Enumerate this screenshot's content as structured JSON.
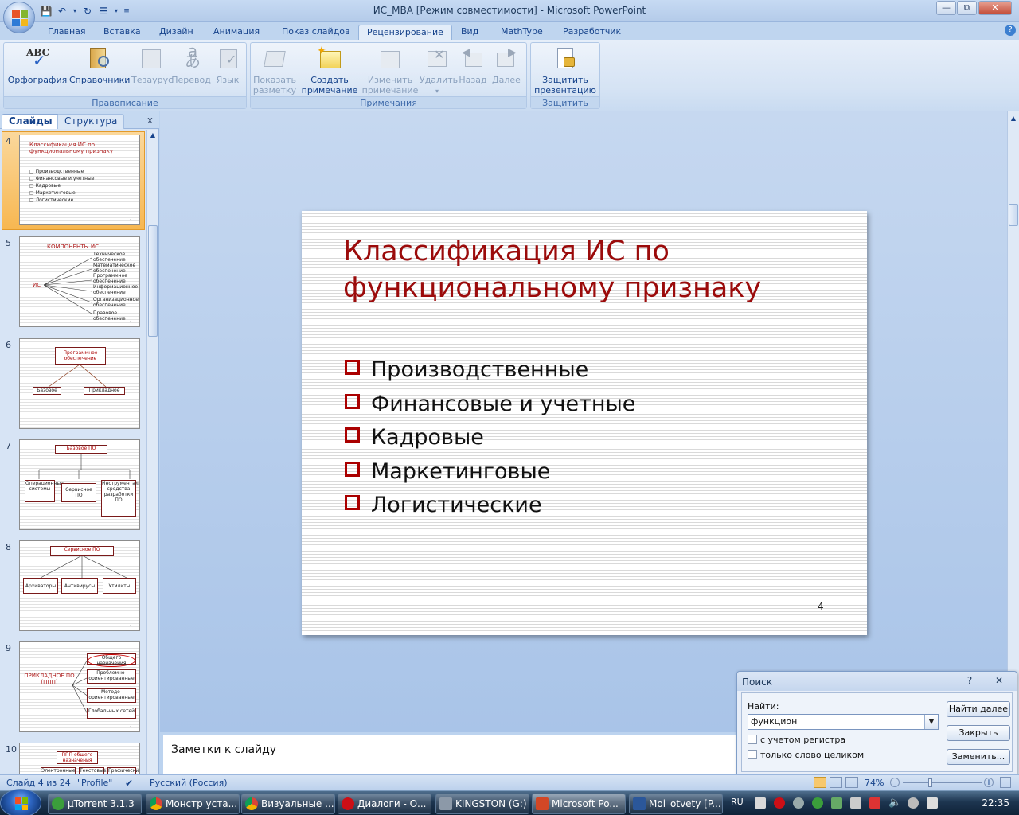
{
  "window": {
    "title": "ИС_МВА [Режим совместимости] - Microsoft PowerPoint"
  },
  "tabs": [
    "Главная",
    "Вставка",
    "Дизайн",
    "Анимация",
    "Показ слайдов",
    "Рецензирование",
    "Вид",
    "MathType",
    "Разработчик"
  ],
  "active_tab": "Рецензирование",
  "ribbon": {
    "groups": [
      {
        "label": "Правописание",
        "buttons": [
          "Орфография",
          "Справочники",
          "Тезаурус",
          "Перевод",
          "Язык"
        ]
      },
      {
        "label": "Примечания",
        "buttons": [
          "Показать разметку",
          "Создать примечание",
          "Изменить примечание",
          "Удалить",
          "Назад",
          "Далее"
        ]
      },
      {
        "label": "Защитить",
        "buttons": [
          "Защитить презентацию"
        ]
      }
    ],
    "b": {
      "spell": "Орфография",
      "research": "Справочники",
      "thesaurus": "Тезаурус",
      "translate": "Перевод",
      "language": "Язык",
      "show1": "Показать",
      "show2": "разметку",
      "new1": "Создать",
      "new2": "примечание",
      "edit1": "Изменить",
      "edit2": "примечание",
      "delete": "Удалить",
      "prev": "Назад",
      "next": "Далее",
      "protect1": "Защитить",
      "protect2": "презентацию"
    },
    "g": {
      "proofing": "Правописание",
      "comments": "Примечания",
      "protect": "Защитить"
    }
  },
  "left_pane": {
    "tab_slides": "Слайды",
    "tab_outline": "Структура",
    "close": "x",
    "slides": [
      {
        "num": "4",
        "title": "Классификация ИС по функциональному признаку",
        "items": [
          "Производственные",
          "Финансовые и учетные",
          "Кадровые",
          "Маркетинговые",
          "Логистические"
        ]
      },
      {
        "num": "5",
        "title": "КОМПОНЕНТЫ ИС",
        "root": "ИС",
        "items": [
          "Техническое обеспечение",
          "Математическое обеспечение",
          "Программное обеспечение",
          "Информационное обеспечение",
          "Организационное обеспечение",
          "Правовое обеспечение"
        ]
      },
      {
        "num": "6",
        "top": "Программное обеспечение",
        "items": [
          "Базовое",
          "Прикладное"
        ]
      },
      {
        "num": "7",
        "top": "Базовое ПО",
        "items": [
          "Операционные системы",
          "Сервисное ПО",
          "Инструментальные средства разработки ПО"
        ]
      },
      {
        "num": "8",
        "top": "Сервисное ПО",
        "items": [
          "Архиваторы",
          "Антивирусы",
          "Утилиты"
        ]
      },
      {
        "num": "9",
        "root": "ПРИКЛАДНОЕ ПО (ППП)",
        "items": [
          "Общего назначения",
          "Проблемно-ориентированные",
          "Методо-ориентированные",
          "Глобальных сетей"
        ]
      },
      {
        "num": "10",
        "top": "ППП общего назначения",
        "items": [
          "Электронные",
          "Текстовые",
          "Графические"
        ]
      }
    ]
  },
  "slide": {
    "title": "Классификация ИС по функциональному признаку",
    "bullets": [
      "Производственные",
      "Финансовые и учетные",
      "Кадровые",
      "Маркетинговые",
      "Логистические"
    ],
    "page_number": "4"
  },
  "notes": {
    "placeholder": "Заметки к слайду"
  },
  "find_dialog": {
    "title": "Поиск",
    "help": "?",
    "close": "✕",
    "find_label": "Найти:",
    "find_value": "функцион",
    "match_case": "с учетом регистра",
    "whole_word": "только слово целиком",
    "btn_find_next": "Найти далее",
    "btn_close": "Закрыть",
    "btn_replace": "Заменить..."
  },
  "status": {
    "slide_of": "Слайд 4 из 24",
    "theme": "\"Profile\"",
    "language": "Русский (Россия)",
    "zoom": "74%"
  },
  "taskbar": {
    "items": [
      "µTorrent 3.1.3",
      "Монстр уста...",
      "Визуальные ...",
      "Диалоги - О...",
      "KINGSTON (G:)",
      "Microsoft Po...",
      "Moi_otvety [P..."
    ],
    "lang": "RU",
    "clock": "22:35"
  },
  "colors": {
    "title_red": "#9b0b0b",
    "accent_blue": "#15428b",
    "selection_orange": "#f7b751"
  }
}
